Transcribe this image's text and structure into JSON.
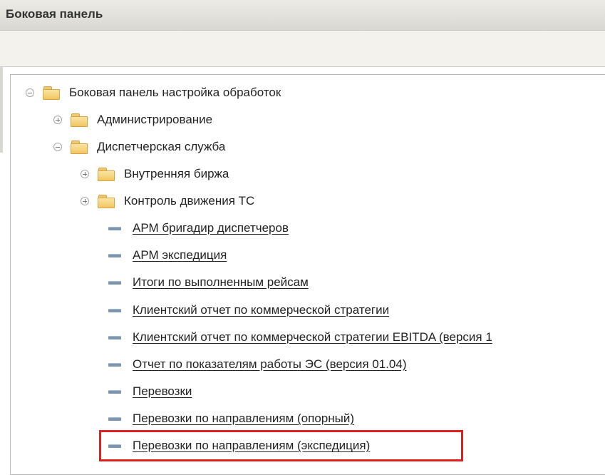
{
  "window": {
    "title": "Боковая панель"
  },
  "tree": [
    {
      "label": "Боковая панель настройка обработок",
      "kind": "folder",
      "expander": "minus",
      "link": false
    },
    {
      "label": "Администрирование",
      "kind": "folder",
      "expander": "plus",
      "link": false
    },
    {
      "label": "Диспетчерская служба",
      "kind": "folder",
      "expander": "minus",
      "link": false
    },
    {
      "label": "Внутренняя биржа",
      "kind": "folder",
      "expander": "plus",
      "link": false
    },
    {
      "label": "Контроль движения ТС",
      "kind": "folder",
      "expander": "plus",
      "link": false
    },
    {
      "label": "АРМ бригадир диспетчеров",
      "kind": "item",
      "link": true
    },
    {
      "label": "АРМ экспедиция",
      "kind": "item",
      "link": true
    },
    {
      "label": "Итоги по выполненным рейсам",
      "kind": "item",
      "link": true
    },
    {
      "label": "Клиентский отчет по коммерческой стратегии",
      "kind": "item",
      "link": true
    },
    {
      "label": "Клиентский отчет по коммерческой стратегии EBITDA (версия 1",
      "kind": "item",
      "link": true
    },
    {
      "label": "Отчет по показателям работы ЭС (версия 01.04)",
      "kind": "item",
      "link": true
    },
    {
      "label": "Перевозки",
      "kind": "item",
      "link": true
    },
    {
      "label": "Перевозки по направлениям (опорный)",
      "kind": "item",
      "link": true
    },
    {
      "label": "Перевозки по направлениям (экспедиция)",
      "kind": "item",
      "link": true,
      "highlighted": true
    }
  ],
  "colors": {
    "highlight_border": "#e0201f",
    "folder": "#f2c763",
    "item_dash": "#7e95b0"
  }
}
